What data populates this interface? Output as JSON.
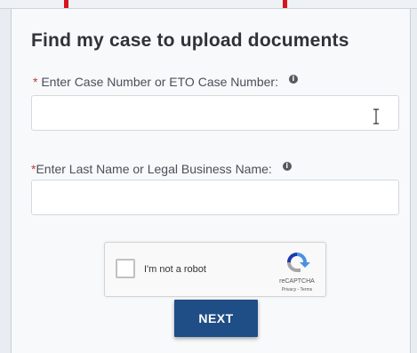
{
  "form": {
    "title": "Find my case to upload documents",
    "case_number": {
      "required_mark": "*",
      "label": "Enter Case Number or ETO Case Number:",
      "value": "",
      "info_icon": "info-icon"
    },
    "last_name": {
      "required_mark": "*",
      "label": "Enter Last Name or Legal Business Name:",
      "value": "",
      "info_icon": "info-icon"
    },
    "captcha": {
      "label": "I'm not a robot",
      "brand": "reCAPTCHA",
      "links": "Privacy - Terms",
      "checked": false
    },
    "next_label": "NEXT"
  },
  "colors": {
    "required": "#c43b3b",
    "button": "#1f4d86",
    "top_marks": "#d8131d"
  }
}
